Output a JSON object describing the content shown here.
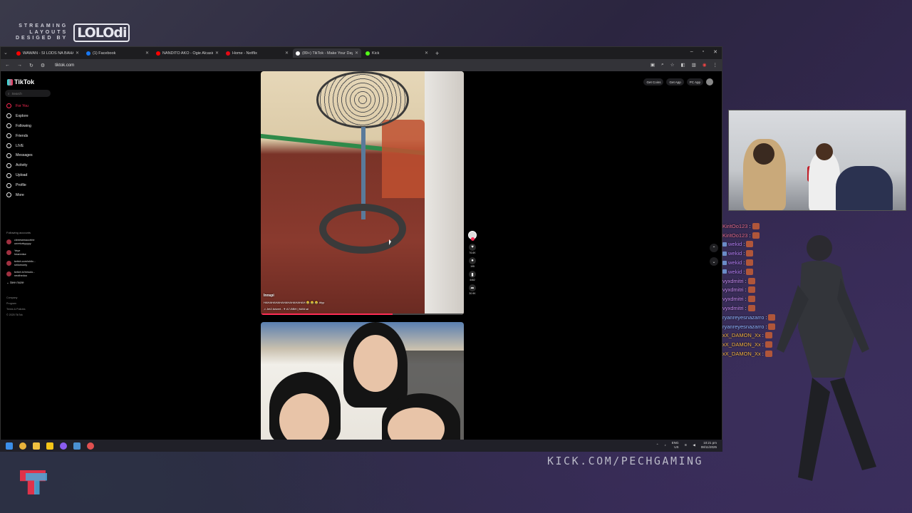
{
  "overlay": {
    "brand_line1": "STREAMING",
    "brand_line2": "LAYOUTS",
    "brand_line3": "DESIGED BY",
    "brand_logo": "LOLOdi",
    "kick_url": "KICK.COM/PECHGAMING"
  },
  "browser": {
    "tabs": [
      {
        "title": "WAWAN - SI LODS NA BAHALA",
        "color": "#ff0000",
        "active": false
      },
      {
        "title": "(1) Facebook",
        "color": "#1877f2",
        "active": false
      },
      {
        "title": "NANDITO AKO - Ogie Alcasid",
        "color": "#ff0000",
        "active": false
      },
      {
        "title": "Home - Netflix",
        "color": "#e50914",
        "active": false
      },
      {
        "title": "(89+) TikTok - Make Your Day",
        "color": "#ffffff",
        "active": true
      },
      {
        "title": "Kick",
        "color": "#53fc18",
        "active": false
      }
    ],
    "url": "tiktok.com"
  },
  "tiktok": {
    "logo": "TikTok",
    "search_placeholder": "Search",
    "nav": [
      {
        "label": "For You",
        "active": true,
        "icon": "home-icon"
      },
      {
        "label": "Explore",
        "active": false,
        "icon": "compass-icon"
      },
      {
        "label": "Following",
        "active": false,
        "icon": "following-icon"
      },
      {
        "label": "Friends",
        "active": false,
        "icon": "friends-icon"
      },
      {
        "label": "LIVE",
        "active": false,
        "icon": "live-icon"
      },
      {
        "label": "Messages",
        "active": false,
        "icon": "messages-icon"
      },
      {
        "label": "Activity",
        "active": false,
        "icon": "activity-icon"
      },
      {
        "label": "Upload",
        "active": false,
        "icon": "upload-icon"
      },
      {
        "label": "Profile",
        "active": false,
        "icon": "profile-icon"
      },
      {
        "label": "More",
        "active": false,
        "icon": "more-icon"
      }
    ],
    "following_title": "Following accounts",
    "following": [
      {
        "name": "cleeeseeaocelrie",
        "handle": "unreturbyyyyy"
      },
      {
        "name": "Yeye",
        "handle": "heamntse"
      },
      {
        "name": "twitch.com/shilo...",
        "handle": "shilomonty"
      },
      {
        "name": "twitch.tv/mrsolo...",
        "handle": "neothedoo"
      }
    ],
    "see_more": "See more",
    "footer": [
      "Company",
      "Program",
      "Terms & Policies",
      "© 2025 TikTok"
    ],
    "top_buttons": [
      "Get Coins",
      "Get App",
      "PC App"
    ],
    "video1": {
      "user": "Innspi",
      "caption": "HAHAHAHAHAHAHAHAHAHAH 😂 😂 😂 #fyp",
      "music": "♫ Jet2 Advert - ✈ A7-BBH | MAN ⇌",
      "progress": 0.65
    },
    "actions": {
      "likes": "76.6K",
      "comments": "195",
      "saves": "4462",
      "shares": "30.9K"
    }
  },
  "chat": [
    {
      "user": "KiritOo123",
      "color": "#e06a8a"
    },
    {
      "user": "KiritOo123",
      "color": "#e06a8a"
    },
    {
      "user": "wekid",
      "color": "#b07cf0"
    },
    {
      "user": "wekid",
      "color": "#b07cf0"
    },
    {
      "user": "wekid",
      "color": "#b07cf0"
    },
    {
      "user": "wekid",
      "color": "#b07cf0"
    },
    {
      "user": "vyxdmitri",
      "color": "#c68af0"
    },
    {
      "user": "vyxdmitri",
      "color": "#c68af0"
    },
    {
      "user": "vyxdmitri",
      "color": "#c68af0"
    },
    {
      "user": "vyxdmitri",
      "color": "#c68af0"
    },
    {
      "user": "ryanreyesnazarro",
      "color": "#8fb4ff"
    },
    {
      "user": "ryanreyesnazarro",
      "color": "#8fb4ff"
    },
    {
      "user": "xX_DAMON_Xx",
      "color": "#f0b040"
    },
    {
      "user": "xX_DAMON_Xx",
      "color": "#f0b040"
    },
    {
      "user": "xX_DAMON_Xx",
      "color": "#f0b040"
    }
  ],
  "taskbar": {
    "lang": "ENG",
    "region": "US",
    "time": "10:21 pm",
    "date": "08/11/2025"
  }
}
